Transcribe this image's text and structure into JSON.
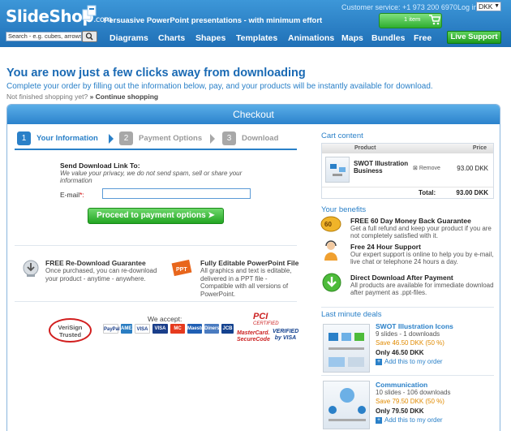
{
  "header": {
    "logo": "SlideShop",
    "logo_suffix": ".com",
    "tagline": "Persuasive PowerPoint presentations - with minimum effort",
    "customer_service": "Customer service: +1 973 200 6970",
    "login": "Log in",
    "currency": "DKK",
    "cart_label": "1 item",
    "search_placeholder": "Search - e.g. cubes, arrows...",
    "nav": [
      "Diagrams",
      "Charts",
      "Shapes",
      "Templates",
      "Animations",
      "Maps",
      "Bundles",
      "Free"
    ],
    "live_support": "Live Support"
  },
  "intro": {
    "title": "You are now just a few clicks away from downloading",
    "subtitle": "Complete your order by filling out the information below, pay, and your products will be instantly available for download.",
    "not_finished": "Not finished shopping yet?",
    "continue": "» Continue shopping"
  },
  "checkout": {
    "title": "Checkout",
    "steps": [
      {
        "num": "1",
        "label": "Your Information"
      },
      {
        "num": "2",
        "label": "Payment Options"
      },
      {
        "num": "3",
        "label": "Download"
      }
    ],
    "download_title": "Send Download Link To:",
    "privacy": "We value your privacy, we do not send spam, sell or share your information",
    "email_label": "E-mail",
    "email_required": "*:",
    "proceed": "Proceed to payment options",
    "features": [
      {
        "title": "FREE Re-Download Guarantee",
        "text": "Once purchased, you can re-download your product - anytime - anywhere."
      },
      {
        "title": "Fully Editable PowerPoint File",
        "text": "All graphics and text is editable, delivered in a PPT file - Compatible with all versions of PowerPoint."
      }
    ],
    "accept_label": "We accept:",
    "cards": [
      "PayPal",
      "AMEX",
      "VISA",
      "VISA",
      "MC",
      "Maestro",
      "Diners",
      "JCB"
    ],
    "verisign": "VeriSign Trusted",
    "pci": "PCI",
    "pci_sub": "CERTIFIED",
    "mastercard": "MasterCard. SecureCode",
    "verified": "VERIFIED by VISA"
  },
  "cart": {
    "heading": "Cart content",
    "col_product": "Product",
    "col_price": "Price",
    "item_name": "SWOT Illustration Business",
    "remove": "Remove",
    "item_price": "93.00 DKK",
    "total_label": "Total:",
    "total_value": "93.00 DKK"
  },
  "benefits": {
    "heading": "Your benefits",
    "items": [
      {
        "title": "FREE 60 Day Money Back Guarantee",
        "text": "Get a full refund and keep your product if you are not completely satisfied with it."
      },
      {
        "title": "Free 24 Hour Support",
        "text": "Our expert support is online to help you by e-mail, live chat or telephone 24 hours a day."
      },
      {
        "title": "Direct Download After Payment",
        "text": "All products are available for immediate download after payment as .ppt-files."
      }
    ]
  },
  "deals": {
    "heading": "Last minute deals",
    "items": [
      {
        "title": "SWOT Illustration Icons",
        "meta": "9 slides - 1 downloads",
        "save": "Save 46.50 DKK (50 %)",
        "only": "Only 46.50 DKK",
        "add": "Add this to my order"
      },
      {
        "title": "Communication",
        "meta": "10 slides - 106 downloads",
        "save": "Save 79.50 DKK (50 %)",
        "only": "Only 79.50 DKK",
        "add": "Add this to my order"
      }
    ]
  },
  "colors": {
    "brand_blue": "#2a80c8",
    "green": "#2fae2f",
    "save_orange": "#e08a00"
  }
}
